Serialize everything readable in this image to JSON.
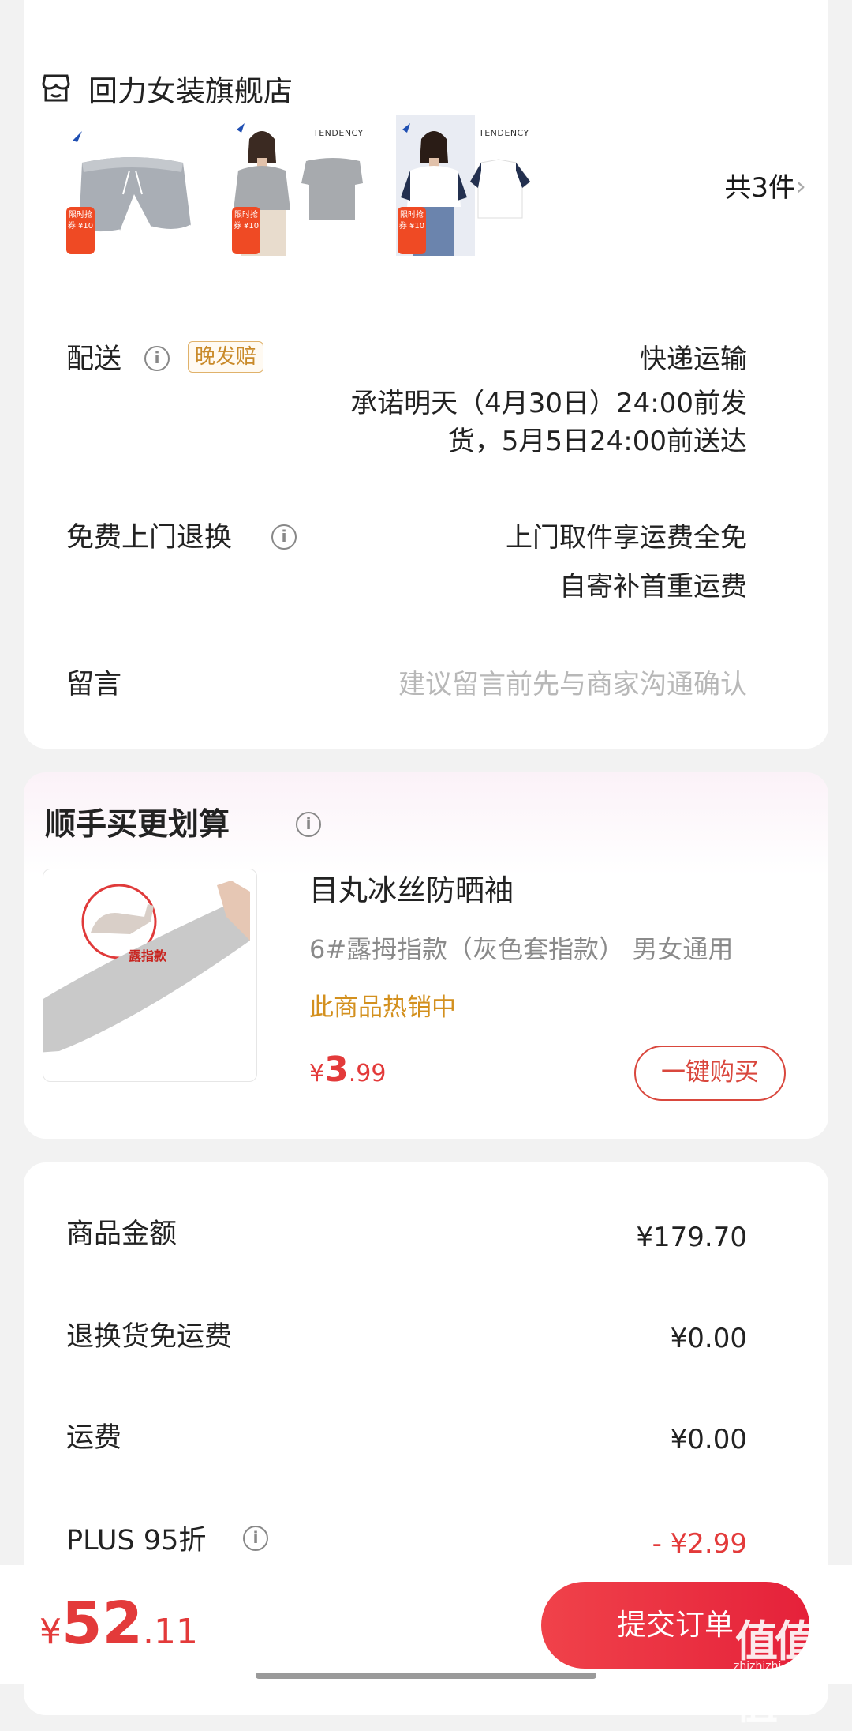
{
  "store": {
    "name": "回力女装旗舰店",
    "count_label": "共3件",
    "thumbnails": [
      {
        "promo": "限时抢券 ¥10",
        "tag": ""
      },
      {
        "promo": "限时抢券 ¥10",
        "tag": "TENDENCY"
      },
      {
        "promo": "限时抢券 ¥10",
        "tag": "TENDENCY"
      }
    ]
  },
  "delivery": {
    "label": "配送",
    "badge": "晚发赔",
    "method": "快递运输",
    "promise_line1": "承诺明天（4月30日）24:00前发",
    "promise_line2": "货，5月5日24:00前送达"
  },
  "returns": {
    "label": "免费上门退换",
    "line1": "上门取件享运费全免",
    "line2": "自寄补首重运费"
  },
  "message": {
    "label": "留言",
    "placeholder": "建议留言前先与商家沟通确认"
  },
  "upsell": {
    "title": "顺手买更划算",
    "product_name": "目丸冰丝防晒袖",
    "image_tag": "露指款",
    "spec": "6#露拇指款（灰色套指款）  男女通用",
    "hot": "此商品热销中",
    "price_symbol": "¥",
    "price_int": "3",
    "price_dec": ".99",
    "buy_label": "一键购买"
  },
  "summary": {
    "rows": [
      {
        "label": "商品金额",
        "value": "¥179.70"
      },
      {
        "label": "退换货免运费",
        "value": "¥0.00"
      },
      {
        "label": "运费",
        "value": "¥0.00"
      },
      {
        "label": "PLUS 95折",
        "value": "- ¥2.99"
      }
    ]
  },
  "footer": {
    "total_symbol": "¥",
    "total_int": "52",
    "total_dec": ".11",
    "submit_label": "提交订单",
    "watermark": "值值值",
    "watermark_url": "zhizhizhi.com"
  },
  "colors": {
    "accent_red": "#e33a3a",
    "hot_orange": "#d3901e",
    "badge_gold": "#c98a2a"
  }
}
